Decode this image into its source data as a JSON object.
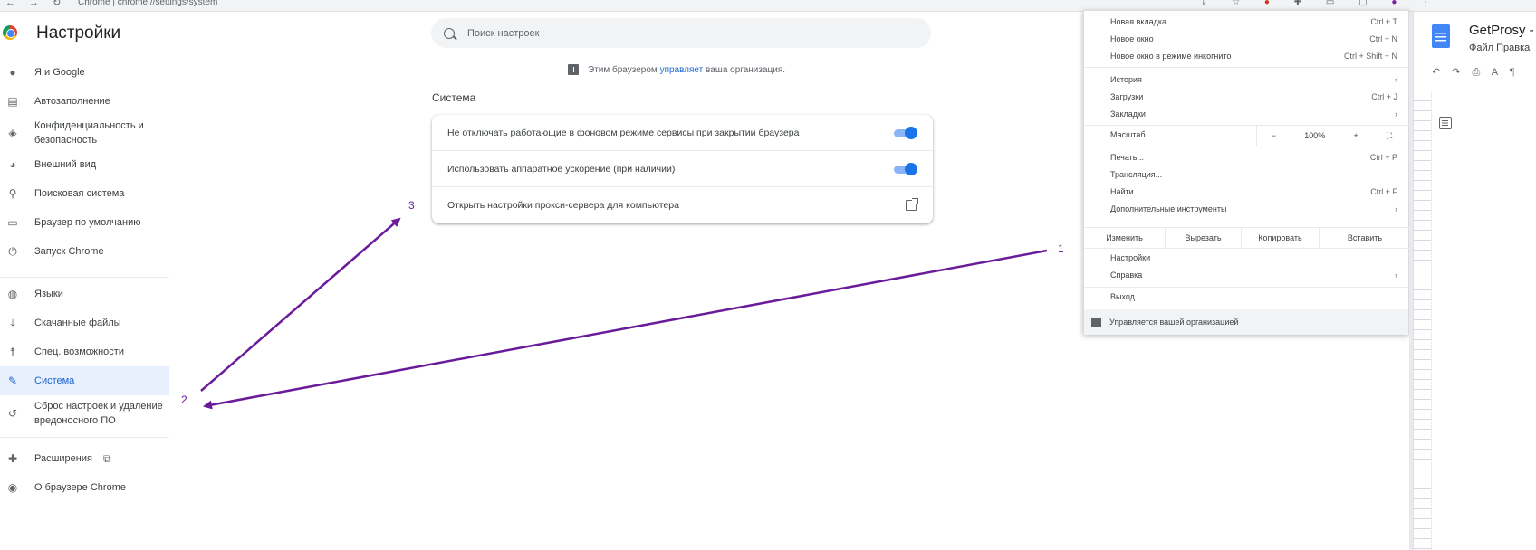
{
  "browser": {
    "nav_glyphs": "← → ↻",
    "url": "Chrome | chrome://settings/system",
    "toolbar_icons": [
      "share-icon",
      "star-icon",
      "extension-red-icon",
      "puzzle-icon",
      "window-icon",
      "profile-icon",
      "kebab-menu-icon"
    ]
  },
  "header": {
    "title": "Настройки"
  },
  "search": {
    "placeholder": "Поиск настроек"
  },
  "sidebar": {
    "items": [
      {
        "label": "Я и Google",
        "icon": "person-icon"
      },
      {
        "label": "Автозаполнение",
        "icon": "clipboard-icon"
      },
      {
        "label": "Конфиденциальность и безопасность",
        "icon": "shield-icon"
      },
      {
        "label": "Внешний вид",
        "icon": "palette-icon"
      },
      {
        "label": "Поисковая система",
        "icon": "search-icon"
      },
      {
        "label": "Браузер по умолчанию",
        "icon": "browser-icon"
      },
      {
        "label": "Запуск Chrome",
        "icon": "power-icon"
      },
      {
        "label": "Языки",
        "icon": "globe-icon"
      },
      {
        "label": "Скачанные файлы",
        "icon": "download-icon"
      },
      {
        "label": "Спец. возможности",
        "icon": "accessibility-icon"
      },
      {
        "label": "Система",
        "icon": "wrench-icon",
        "active": true
      },
      {
        "label": "Сброс настроек и удаление вредоносного ПО",
        "icon": "restore-icon"
      },
      {
        "label": "Расширения",
        "icon": "puzzle-icon"
      },
      {
        "label": "О браузере Chrome",
        "icon": "chrome-icon"
      }
    ]
  },
  "managed_notice": {
    "prefix": "Этим браузером ",
    "link": "управляет",
    "suffix": " ваша организация."
  },
  "section": {
    "title": "Система",
    "rows": [
      {
        "label": "Не отключать работающие в фоновом режиме сервисы при закрытии браузера",
        "control": "toggle",
        "checked": true
      },
      {
        "label": "Использовать аппаратное ускорение (при наличии)",
        "control": "toggle",
        "checked": true
      },
      {
        "label": "Открыть настройки прокси-сервера для компьютера",
        "control": "external-link-icon"
      }
    ]
  },
  "menu": {
    "items_top": [
      {
        "label": "Новая вкладка",
        "shortcut": "Ctrl + T"
      },
      {
        "label": "Новое окно",
        "shortcut": "Ctrl + N"
      },
      {
        "label": "Новое окно в режиме инкогнито",
        "shortcut": "Ctrl + Shift + N"
      }
    ],
    "items_mid": [
      {
        "label": "История",
        "shortcut": "›"
      },
      {
        "label": "Загрузки",
        "shortcut": "Ctrl + J"
      },
      {
        "label": "Закладки",
        "shortcut": "›"
      }
    ],
    "zoom": {
      "label": "Масштаб",
      "minus": "−",
      "value": "100%",
      "plus": "+",
      "fullscreen": "⛶"
    },
    "items_tools": [
      {
        "label": "Печать...",
        "shortcut": "Ctrl + P"
      },
      {
        "label": "Трансляция...",
        "shortcut": ""
      },
      {
        "label": "Найти...",
        "shortcut": "Ctrl + F"
      },
      {
        "label": "Дополнительные инструменты",
        "shortcut": "›"
      }
    ],
    "edit": {
      "label": "Изменить",
      "cut": "Вырезать",
      "copy": "Копировать",
      "paste": "Вставить"
    },
    "items_settings": [
      {
        "label": "Настройки",
        "shortcut": ""
      },
      {
        "label": "Справка",
        "shortcut": "›"
      }
    ],
    "exit": "Выход",
    "managed": "Управляется вашей организацией"
  },
  "docs": {
    "title": "GetProsy - H",
    "menus": "Файл  Правка",
    "toolbar": "↶ ↷ ⎙ A ¶"
  },
  "annotations": {
    "n1": "1",
    "n2": "2",
    "n3": "3",
    "color": "#6a1b9a"
  }
}
